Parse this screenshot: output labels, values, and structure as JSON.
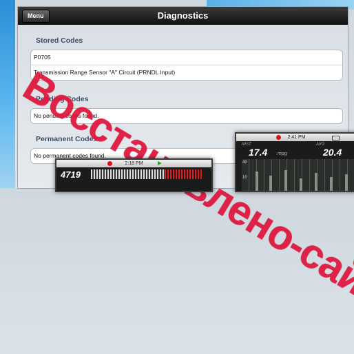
{
  "app": {
    "nav_title": "Diagnostics",
    "menu_label": "Menu"
  },
  "sections": {
    "stored": {
      "title": "Stored Codes",
      "rows": [
        "P0705",
        "Transmission Range Sensor \"A\" Circuit (PRNDL Input)"
      ]
    },
    "pending": {
      "title": "Pending Codes",
      "rows": [
        "No pending codes found."
      ]
    },
    "permanent": {
      "title": "Permanent Codes",
      "rows": [
        "No permanent codes found."
      ]
    }
  },
  "watermark": "Восстановлено-сайтами",
  "overlay_left": {
    "time": "2:18 PM",
    "rpm_value": "4719"
  },
  "overlay_right": {
    "time": "2:41 PM",
    "inst_label": "INST",
    "inst_value": "17.4",
    "inst_unit": "mpg",
    "avg_label": "AVG",
    "avg_value": "20.4",
    "axis_top": "40",
    "axis_low": "10"
  },
  "colors": {
    "nav_bg": "#111111",
    "section_title": "#3d4e69",
    "watermark": "#e0143c",
    "record_dot": "#dd1111"
  }
}
